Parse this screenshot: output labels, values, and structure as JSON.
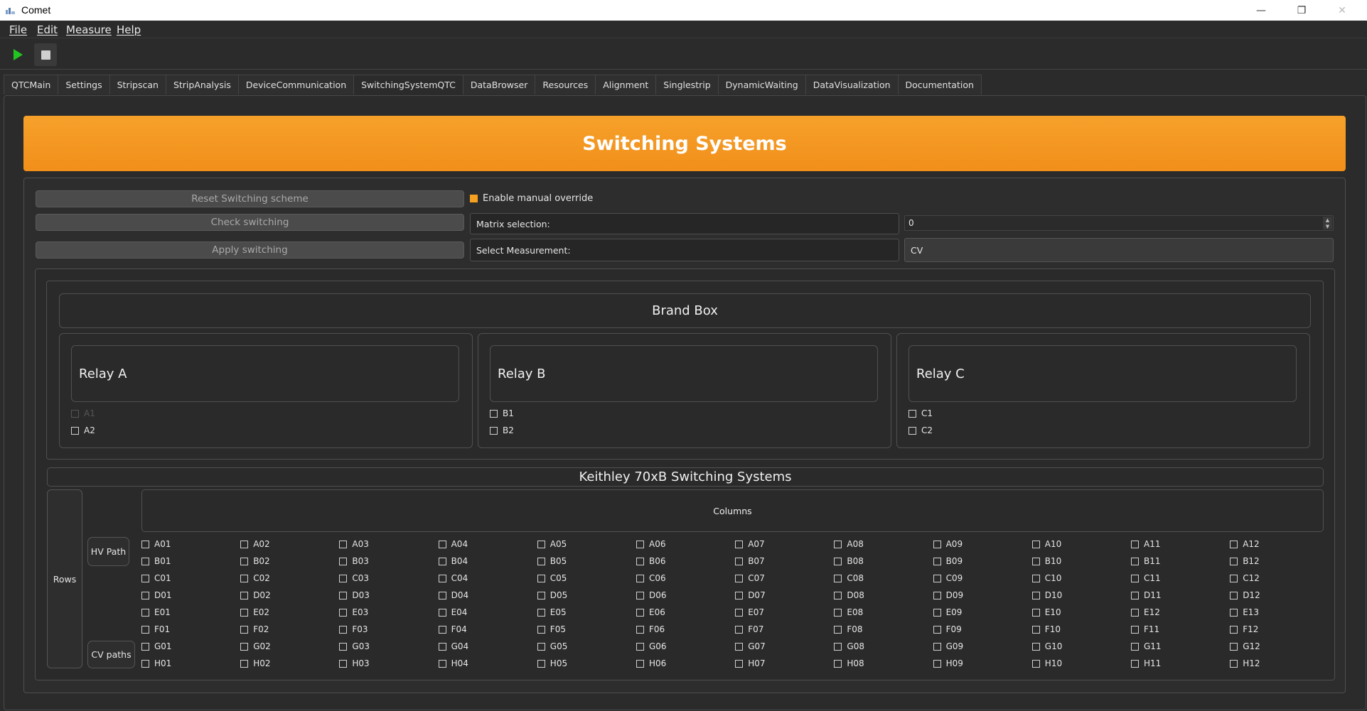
{
  "window": {
    "title": "Comet",
    "min": "—",
    "max": "❐",
    "close": "✕"
  },
  "menu": {
    "items": [
      "File",
      "Edit",
      "Measure",
      "Help"
    ]
  },
  "tabs": [
    "QTCMain",
    "Settings",
    "Stripscan",
    "StripAnalysis",
    "DeviceCommunication",
    "SwitchingSystemQTC",
    "DataBrowser",
    "Resources",
    "Alignment",
    "Singlestrip",
    "DynamicWaiting",
    "DataVisualization",
    "Documentation"
  ],
  "active_tab": "SwitchingSystemQTC",
  "banner": {
    "title": "Switching Systems"
  },
  "controls": {
    "reset_label": "Reset Switching scheme",
    "check_label": "Check switching",
    "apply_label": "Apply switching",
    "override_label": "Enable manual override",
    "matrix_label": "Matrix selection:",
    "matrix_value": "0",
    "measurement_label": "Select Measurement:",
    "measurement_value": "CV"
  },
  "brandbox": {
    "title": "Brand Box",
    "relays": [
      {
        "label": "Relay A",
        "channels": [
          {
            "name": "A1",
            "disabled": true
          },
          {
            "name": "A2",
            "disabled": false
          }
        ]
      },
      {
        "label": "Relay B",
        "channels": [
          {
            "name": "B1",
            "disabled": false
          },
          {
            "name": "B2",
            "disabled": false
          }
        ]
      },
      {
        "label": "Relay C",
        "channels": [
          {
            "name": "C1",
            "disabled": false
          },
          {
            "name": "C2",
            "disabled": false
          }
        ]
      }
    ]
  },
  "keithley": {
    "title": "Keithley 70xB Switching Systems",
    "columns_label": "Columns",
    "rows_label": "Rows",
    "hv_path_label": "HV Path",
    "cv_paths_label": "CV paths",
    "row_letters": [
      "A",
      "B",
      "C",
      "D",
      "E",
      "F",
      "G",
      "H"
    ],
    "grid": [
      [
        "A01",
        "A02",
        "A03",
        "A04",
        "A05",
        "A06",
        "A07",
        "A08",
        "A09",
        "A10",
        "A11",
        "A12"
      ],
      [
        "B01",
        "B02",
        "B03",
        "B04",
        "B05",
        "B06",
        "B07",
        "B08",
        "B09",
        "B10",
        "B11",
        "B12"
      ],
      [
        "C01",
        "C02",
        "C03",
        "C04",
        "C05",
        "C06",
        "C07",
        "C08",
        "C09",
        "C10",
        "C11",
        "C12"
      ],
      [
        "D01",
        "D02",
        "D03",
        "D04",
        "D05",
        "D06",
        "D07",
        "D08",
        "D09",
        "D10",
        "D11",
        "D12"
      ],
      [
        "E01",
        "E02",
        "E03",
        "E04",
        "E05",
        "E06",
        "E07",
        "E08",
        "E09",
        "E10",
        "E12",
        "E13"
      ],
      [
        "F01",
        "F02",
        "F03",
        "F04",
        "F05",
        "F06",
        "F07",
        "F08",
        "F09",
        "F10",
        "F11",
        "F12"
      ],
      [
        "G01",
        "G02",
        "G03",
        "G04",
        "G05",
        "G06",
        "G07",
        "G08",
        "G09",
        "G10",
        "G11",
        "G12"
      ],
      [
        "H01",
        "H02",
        "H03",
        "H04",
        "H05",
        "H06",
        "H07",
        "H08",
        "H09",
        "H10",
        "H11",
        "H12"
      ]
    ]
  },
  "colors": {
    "accent": "#f5a020",
    "play": "#22c422",
    "background": "#2b2b2b"
  },
  "icons": {
    "play": "play-icon",
    "stop": "stop-icon"
  }
}
